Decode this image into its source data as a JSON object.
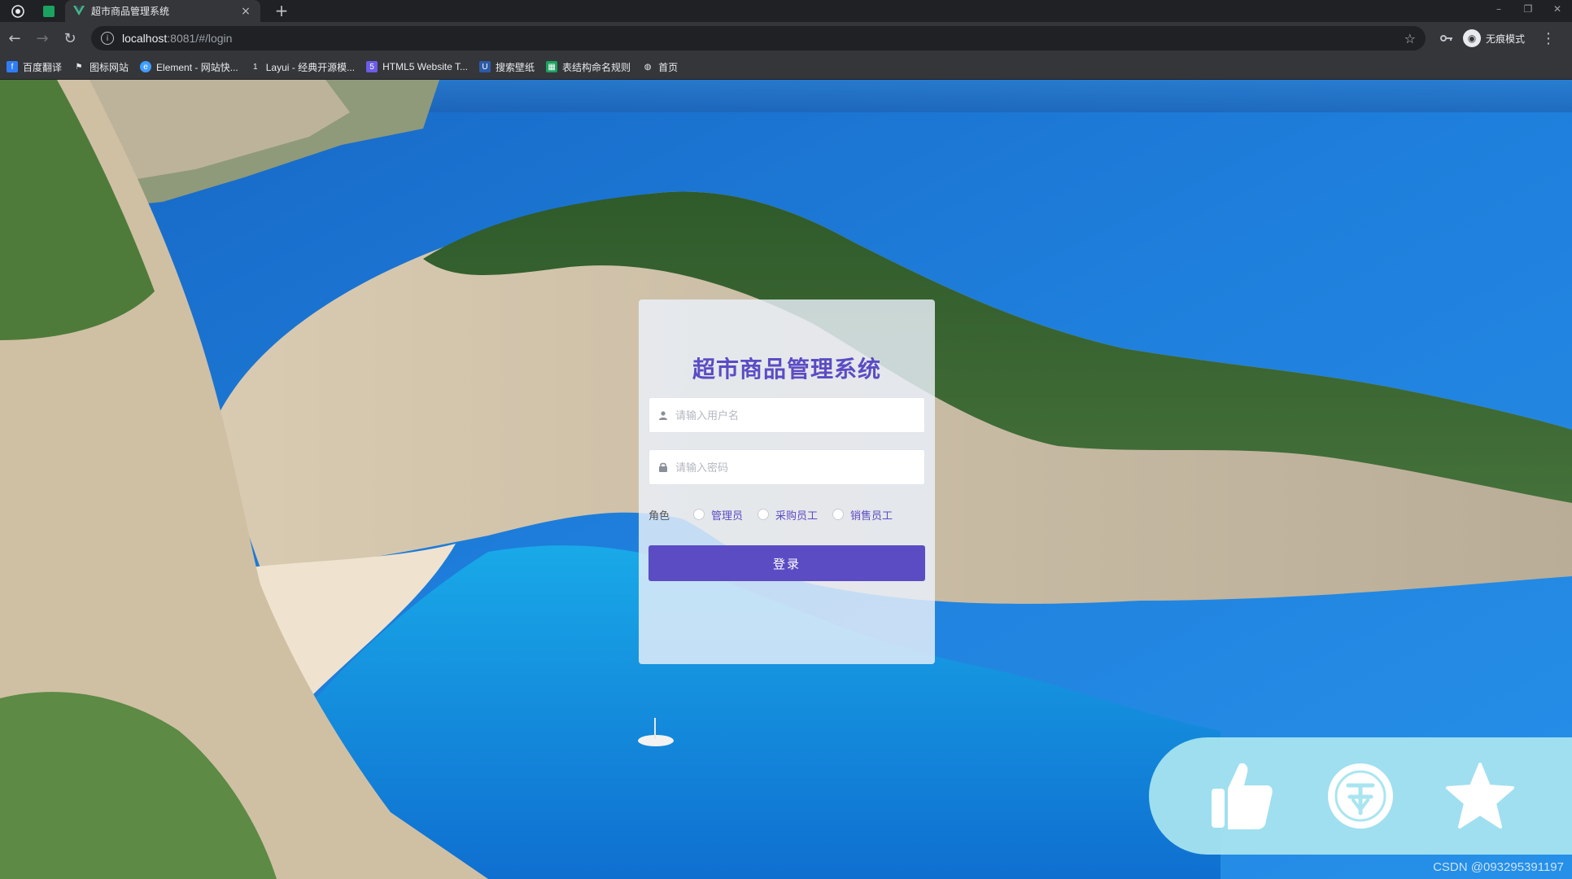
{
  "browser": {
    "tab": {
      "title": "超市商品管理系统",
      "close": "×"
    },
    "new_tab": "+",
    "window_controls": {
      "minimize": "–",
      "maximize": "❐",
      "close": "✕"
    },
    "nav": {
      "back": "←",
      "forward": "→",
      "reload": "↻"
    },
    "address": {
      "host": "localhost",
      "rest": ":8081/#/login"
    },
    "profile": {
      "label": "无痕模式"
    },
    "bookmarks": [
      {
        "label": "百度翻译",
        "icon": "baidu-translate-icon",
        "color": "#2f7df6"
      },
      {
        "label": "图标网站",
        "icon": "flag-icon",
        "color": "#202124"
      },
      {
        "label": "Element - 网站快...",
        "icon": "element-icon",
        "color": "#409eff"
      },
      {
        "label": "Layui - 经典开源模...",
        "icon": "layui-icon",
        "color": "#5a5a5a"
      },
      {
        "label": "HTML5 Website T...",
        "icon": "html5-icon",
        "color": "#6c5ce7"
      },
      {
        "label": "搜索壁纸",
        "icon": "wallpaper-icon",
        "color": "#2c5ba8"
      },
      {
        "label": "表结构命名规则",
        "icon": "sheet-icon",
        "color": "#1aa260"
      },
      {
        "label": "首页",
        "icon": "globe-icon",
        "color": "#5f6368"
      }
    ]
  },
  "login": {
    "title": "超市商品管理系统",
    "username_placeholder": "请输入用户名",
    "password_placeholder": "请输入密码",
    "role_label": "角色",
    "roles": [
      "管理员",
      "采购员工",
      "销售员工"
    ],
    "submit_label": "登录"
  },
  "actions": {
    "like_icon": "thumbs-up-icon",
    "coin_icon": "coin-icon",
    "favorite_icon": "star-icon"
  },
  "watermark": "CSDN @093295391197"
}
